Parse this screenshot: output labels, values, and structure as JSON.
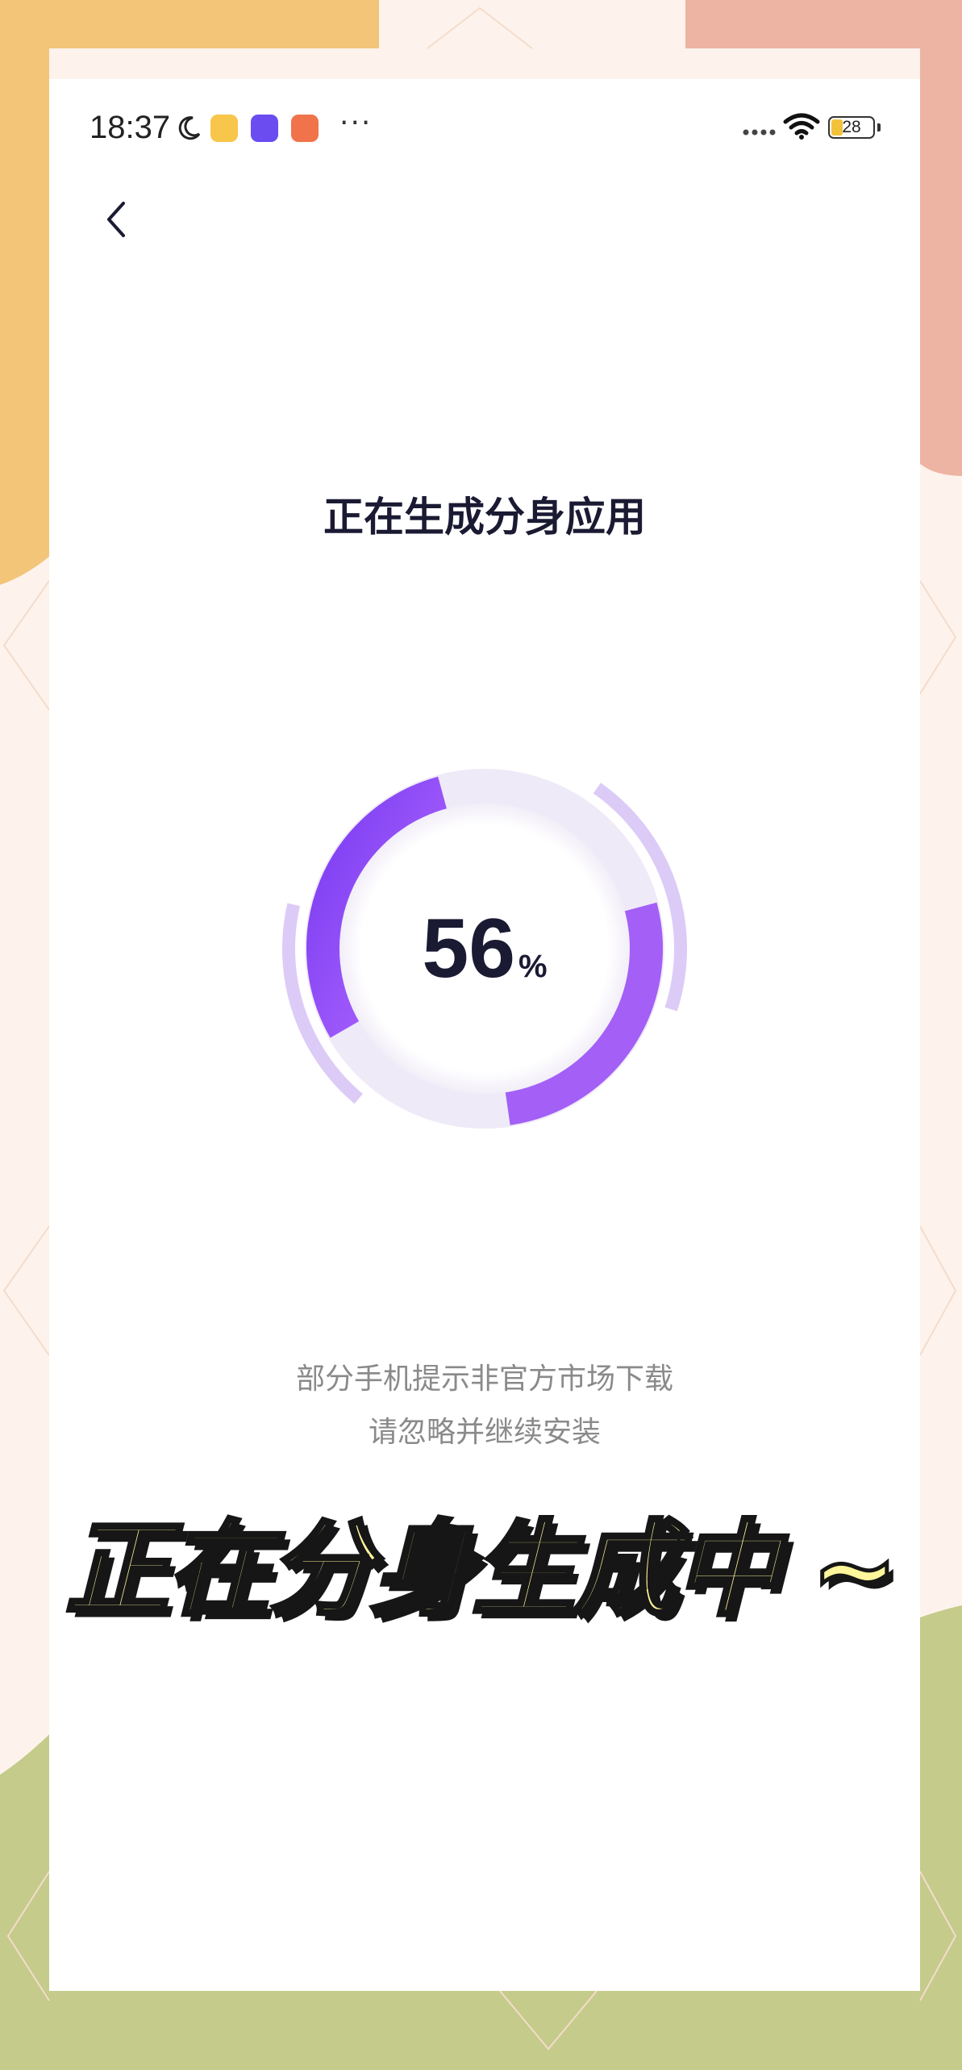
{
  "status_bar": {
    "time": "18:37",
    "battery_level": "28",
    "more_label": "···",
    "icons": [
      "moon-icon",
      "app-badge-icon",
      "app-badge-icon",
      "app-badge-icon",
      "signal-dots-icon",
      "wifi-icon",
      "battery-icon"
    ]
  },
  "header": {
    "back_icon": "chevron-left-icon"
  },
  "main": {
    "title": "正在生成分身应用",
    "progress": {
      "value": "56",
      "unit": "%",
      "fraction": 0.56
    },
    "notice_line_1": "部分手机提示非官方市场下载",
    "notice_line_2": "请忽略并继续安装"
  },
  "caption": "正在分身生成中 ~",
  "colors": {
    "accent_start": "#7b3cf2",
    "accent_end": "#b36bff",
    "track": "#efeaf8",
    "halo": "#dccbf6",
    "caption_fill": "#fff59b",
    "caption_stroke": "#161616"
  }
}
